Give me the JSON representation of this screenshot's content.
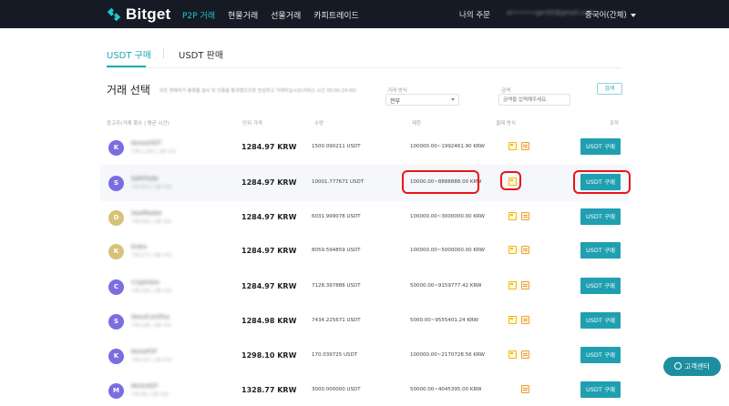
{
  "nav": {
    "brand": "Bitget",
    "items": [
      "P2P 거래",
      "현물거래",
      "선물거래",
      "카피트레이드"
    ],
    "orders": "나의 주문",
    "email": "ar••••••ger92@gmail.com",
    "language": "중국어(간체)"
  },
  "tabs": {
    "buy": "USDT 구매",
    "sell": "USDT 판매"
  },
  "filters": {
    "title": "거래 선택",
    "description": "보든 판매자가 플랫폼 검사 및 인증을 통과했으므로 안심하고 거래하십시오(서비스 시간 00:00-24:00)",
    "method_label": "거래 방식",
    "method_value": "전부",
    "amount_label": "금액",
    "amount_placeholder": "금액을 입력해주세요.",
    "search_button": "검색"
  },
  "table": {
    "headers": {
      "advertiser": "광고주(거래 횟수 | 평균 시간)",
      "price": "단위 가격",
      "quantity": "수량",
      "limit": "제한",
      "payment": "결제 방식",
      "action": "조작"
    },
    "buy_label": "USDT 구매",
    "rows": [
      {
        "initial": "K",
        "color": "#7b6ee0",
        "name": "KoreaUSDT",
        "sub": "거래 1,294 | 1분 이내",
        "price": "1284.97 KRW",
        "qty": "1500.090211 USDT",
        "limit": "100000.00~1992461.90 KRW",
        "payments": [
          "card",
          "bank"
        ]
      },
      {
        "initial": "S",
        "color": "#7b6ee0",
        "name": "SafeTrade",
        "sub": "거래 812 | 2분 이내",
        "price": "1284.97 KRW",
        "qty": "10001.777671 USDT",
        "limit": "10000.00~8888888.00 KRW",
        "payments": [
          "card"
        ]
      },
      {
        "initial": "D",
        "color": "#d8c27a",
        "name": "DealMaster",
        "sub": "거래 503 | 1분 이내",
        "price": "1284.97 KRW",
        "qty": "6031.999078 USDT",
        "limit": "100000.00~3000000.00 KRW",
        "payments": [
          "card",
          "bank"
        ]
      },
      {
        "initial": "K",
        "color": "#d8c27a",
        "name": "Krdex",
        "sub": "거래 377 | 3분 이내",
        "price": "1284.97 KRW",
        "qty": "8059.594859 USDT",
        "limit": "100000.00~5000000.00 KRW",
        "payments": [
          "card",
          "bank"
        ]
      },
      {
        "initial": "C",
        "color": "#7b6ee0",
        "name": "CryptoSeo",
        "sub": "거래 240 | 2분 이내",
        "price": "1284.97 KRW",
        "qty": "7128.397886 USDT",
        "limit": "50000.00~9159777.42 KRW",
        "payments": [
          "card",
          "bank"
        ]
      },
      {
        "initial": "S",
        "color": "#7b6ee0",
        "name": "SeoulCoinPlus",
        "sub": "거래 198 | 4분 이내",
        "price": "1284.98 KRW",
        "qty": "7434.225671 USDT",
        "limit": "5000.00~9555401.24 KRW",
        "payments": [
          "card",
          "bank"
        ]
      },
      {
        "initial": "K",
        "color": "#7b6ee0",
        "name": "KoreaP2P",
        "sub": "거래 155 | 1분 이내",
        "price": "1298.10 KRW",
        "qty": "170.039725 USDT",
        "limit": "100000.00~2170728.56 KRW",
        "payments": [
          "card",
          "bank"
        ]
      },
      {
        "initial": "M",
        "color": "#7b6ee0",
        "name": "MintUSDT",
        "sub": "거래 96 | 5분 이내",
        "price": "1328.77 KRW",
        "qty": "3000.000000 USDT",
        "limit": "50000.00~4045395.00 KRW",
        "payments": [
          "bank"
        ]
      }
    ]
  },
  "support": "고객센터"
}
